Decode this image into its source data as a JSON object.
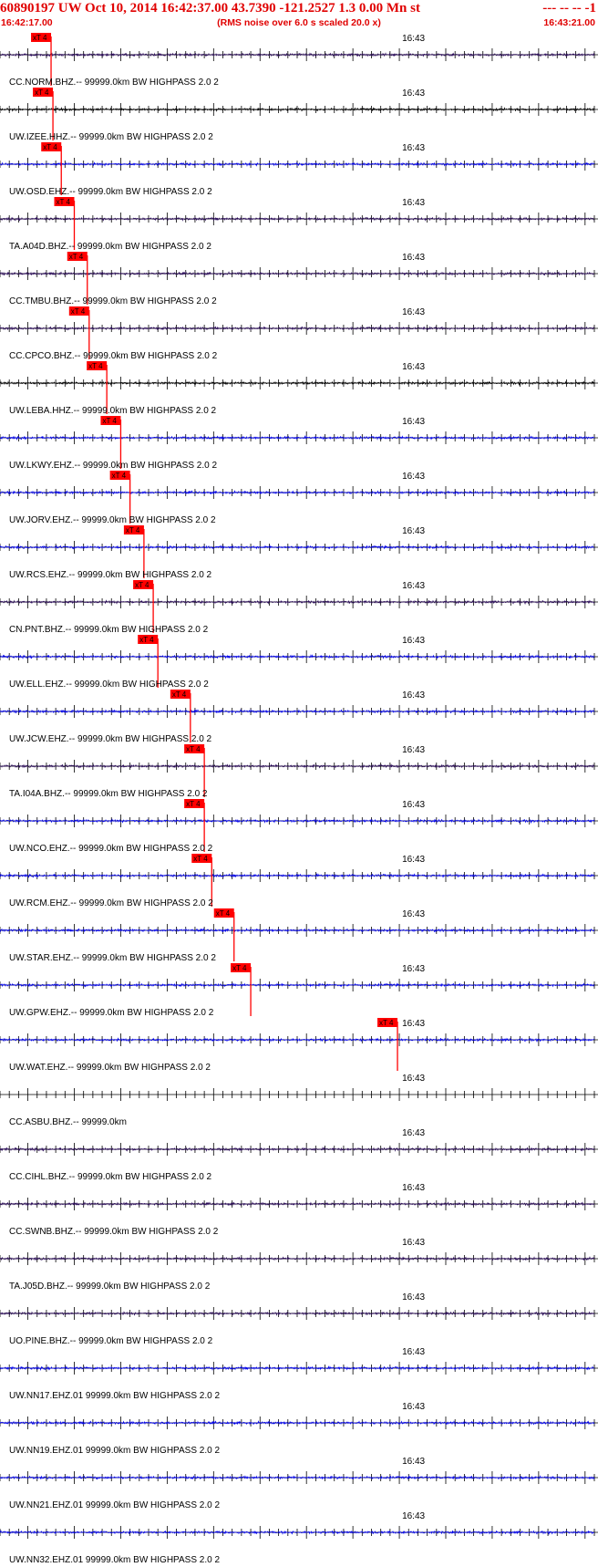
{
  "header": {
    "title_left": "60890197 UW Oct 10, 2014 16:42:37.00   43.7390 -121.2527  1.3 0.00 Mn st",
    "title_right": "--- -- --  -1",
    "start_time": "16:42:17.00",
    "rms_note": "(RMS noise over 6.0 s scaled 20.0 x)",
    "end_time": "16:43:21.00"
  },
  "colors": {
    "header_red": "#e00000",
    "pick_red": "#ff0000",
    "blue": "#0000ee",
    "purple": "#2a0a5a",
    "black": "#000000",
    "grid": "#000000"
  },
  "chart_data": {
    "type": "line",
    "x_start": "16:42:17.00",
    "x_end": "16:43:21.00",
    "minute_label": "16:43",
    "pick_label": "xT 4",
    "traces": [
      {
        "label": "CC.NORM.BHZ.-- 99999.0km BW  HIGHPASS  2.0  2",
        "color": "purple",
        "pick": "16:42:22.5",
        "activity": [
          [
            22.2,
            26,
            0.9
          ],
          [
            27,
            40,
            0.18
          ]
        ]
      },
      {
        "label": "UW.IZEE.HHZ.-- 99999.0km BW  HIGHPASS  2.0  2",
        "color": "black",
        "pick": "16:42:22.7",
        "activity": [
          [
            22.7,
            30,
            0.9
          ],
          [
            30,
            46,
            0.45
          ],
          [
            46,
            58,
            0.55
          ]
        ]
      },
      {
        "label": "UW.OSD.EHZ.-- 99999.0km BW  HIGHPASS  2.0  2",
        "color": "blue",
        "pick": "16:42:23.6",
        "activity": [
          [
            18,
            40,
            0.5
          ],
          [
            40,
            48,
            0.9
          ],
          [
            48,
            64,
            0.6
          ]
        ]
      },
      {
        "label": "TA.A04D.BHZ.-- 99999.0km BW  HIGHPASS  2.0  2",
        "color": "purple",
        "pick": "16:42:25.0",
        "activity": [
          [
            25,
            28,
            0.6
          ],
          [
            38.5,
            40,
            0.45
          ],
          [
            49,
            53,
            0.4
          ],
          [
            54.5,
            56,
            0.45
          ]
        ]
      },
      {
        "label": "CC.TMBU.BHZ.-- 99999.0km BW  HIGHPASS  2.0  2",
        "color": "purple",
        "pick": "16:42:26.4",
        "activity": [
          [
            26.4,
            30,
            0.5
          ]
        ]
      },
      {
        "label": "CC.CPCO.BHZ.-- 99999.0km BW  HIGHPASS  2.0  2",
        "color": "purple",
        "pick": "16:42:26.6",
        "activity": [
          [
            25.5,
            30,
            0.6
          ]
        ]
      },
      {
        "label": "UW.LEBA.HHZ.-- 99999.0km BW  HIGHPASS  2.0  2",
        "color": "black",
        "pick": "16:42:28.5",
        "activity": [
          [
            28.5,
            33,
            0.8
          ],
          [
            33,
            45,
            0.3
          ],
          [
            45,
            58,
            0.4
          ]
        ]
      },
      {
        "label": "UW.LKWY.EHZ.-- 99999.0km BW  HIGHPASS  2.0  2",
        "color": "blue",
        "pick": "16:42:30.0",
        "activity": [
          [
            17,
            30,
            0.35
          ],
          [
            30,
            46.5,
            1.5
          ],
          [
            46.5,
            60,
            0.7
          ]
        ]
      },
      {
        "label": "UW.JORV.EHZ.-- 99999.0km BW  HIGHPASS  2.0  2",
        "color": "blue",
        "pick": "16:42:31.0",
        "activity": [
          [
            17,
            31,
            0.3
          ],
          [
            31,
            35,
            1.5
          ],
          [
            35,
            64,
            0.55
          ]
        ]
      },
      {
        "label": "UW.RCS.EHZ.-- 99999.0km BW  HIGHPASS  2.0  2",
        "color": "blue",
        "pick": "16:42:32.5",
        "activity": [
          [
            32.5,
            35,
            0.7
          ],
          [
            39.5,
            43,
            1.3
          ]
        ]
      },
      {
        "label": "CN.PNT.BHZ.-- 99999.0km BW  HIGHPASS  2.0  2",
        "color": "purple",
        "pick": "16:42:33.5",
        "activity": [
          [
            33.5,
            36,
            0.4
          ]
        ]
      },
      {
        "label": "UW.ELL.EHZ.-- 99999.0km BW  HIGHPASS  2.0  2",
        "color": "blue",
        "pick": "16:42:34.0",
        "activity": [
          [
            34,
            37,
            0.5
          ]
        ]
      },
      {
        "label": "UW.JCW.EHZ.-- 99999.0km BW  HIGHPASS  2.0  2",
        "color": "blue",
        "pick": "16:42:37.5",
        "activity": [
          [
            36,
            40,
            1.0
          ],
          [
            40,
            52,
            0.45
          ]
        ]
      },
      {
        "label": "TA.I04A.BHZ.-- 99999.0km BW  HIGHPASS  2.0  2",
        "color": "purple",
        "pick": "16:42:39.0",
        "activity": [
          [
            39,
            42,
            0.4
          ]
        ]
      },
      {
        "label": "UW.NCO.EHZ.-- 99999.0km BW  HIGHPASS  2.0  2",
        "color": "blue",
        "pick": "16:42:39.0",
        "activity": [
          [
            39,
            47,
            1.2
          ],
          [
            47,
            64,
            0.75
          ]
        ]
      },
      {
        "label": "UW.RCM.EHZ.-- 99999.0km BW  HIGHPASS  2.0  2",
        "color": "blue",
        "pick": "16:42:39.8",
        "activity": [
          [
            39.8,
            44,
            1.5
          ],
          [
            44,
            64,
            0.6
          ]
        ]
      },
      {
        "label": "UW.STAR.EHZ.-- 99999.0km BW  HIGHPASS  2.0  2",
        "color": "blue",
        "pick": "16:42:42.2",
        "activity": [
          [
            42.2,
            45,
            0.9
          ]
        ]
      },
      {
        "label": "UW.GPW.EHZ.-- 99999.0km BW  HIGHPASS  2.0  2",
        "color": "blue",
        "pick": "16:42:44.0",
        "activity": [
          [
            18.5,
            20,
            0.7
          ],
          [
            44,
            46.5,
            1.0
          ],
          [
            51.5,
            52.8,
            0.8
          ]
        ]
      },
      {
        "label": "UW.WAT.EHZ.-- 99999.0km BW  HIGHPASS  2.0  2",
        "color": "blue",
        "pick": "16:42:59.8",
        "activity": [
          [
            59.6,
            61,
            1.3
          ]
        ]
      },
      {
        "label": "CC.ASBU.BHZ.-- 99999.0km",
        "color": "purple",
        "pick": null,
        "flat": true,
        "activity": []
      },
      {
        "label": "CC.CIHL.BHZ.-- 99999.0km BW  HIGHPASS  2.0  2",
        "color": "purple",
        "pick": null,
        "activity": []
      },
      {
        "label": "CC.SWNB.BHZ.-- 99999.0km BW  HIGHPASS  2.0  2",
        "color": "purple",
        "pick": null,
        "activity": []
      },
      {
        "label": "TA.J05D.BHZ.-- 99999.0km BW  HIGHPASS  2.0  2",
        "color": "purple",
        "pick": null,
        "activity": []
      },
      {
        "label": "UO.PINE.BHZ.-- 99999.0km BW  HIGHPASS  2.0  2",
        "color": "purple",
        "pick": null,
        "activity": []
      },
      {
        "label": "UW.NN17.EHZ.01 99999.0km BW  HIGHPASS  2.0  2",
        "color": "blue",
        "pick": null,
        "activity": []
      },
      {
        "label": "UW.NN19.EHZ.01 99999.0km BW  HIGHPASS  2.0  2",
        "color": "blue",
        "pick": null,
        "activity": [
          [
            17,
            64,
            0.3
          ]
        ]
      },
      {
        "label": "UW.NN21.EHZ.01 99999.0km BW  HIGHPASS  2.0  2",
        "color": "blue",
        "pick": null,
        "activity": []
      },
      {
        "label": "UW.NN32.EHZ.01 99999.0km BW  HIGHPASS  2.0  2",
        "color": "blue",
        "pick": null,
        "activity": [
          [
            40,
            46,
            0.3
          ]
        ]
      }
    ]
  }
}
